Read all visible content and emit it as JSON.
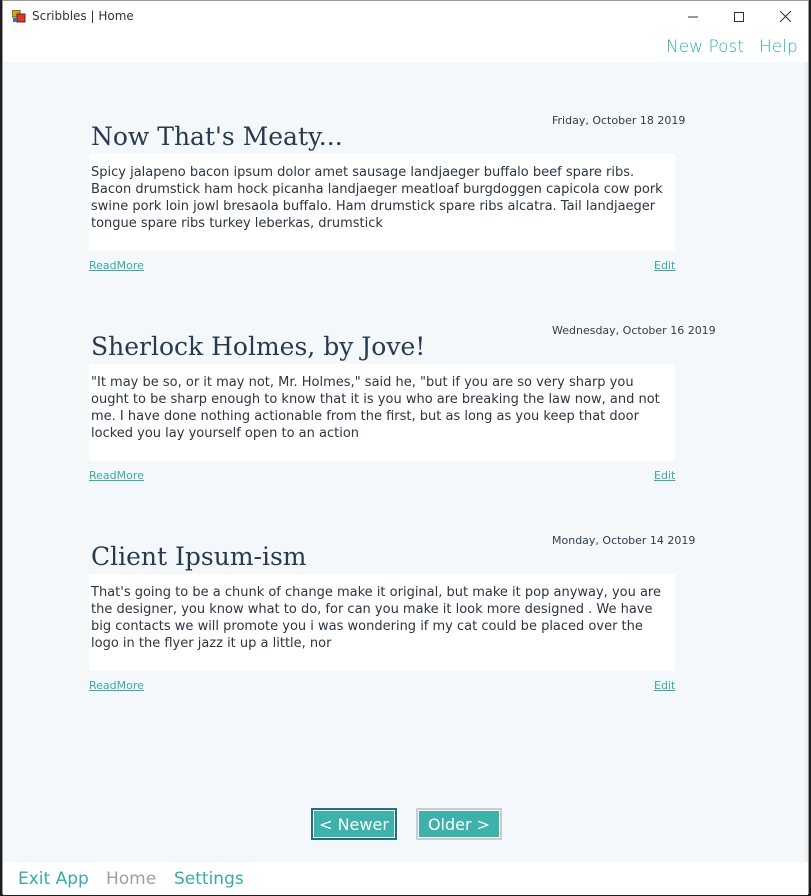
{
  "window": {
    "title": "Scribbles | Home"
  },
  "menu": {
    "new_post": "New Post",
    "help": "Help"
  },
  "posts": [
    {
      "date": "Friday, October 18 2019",
      "title": "Now That's Meaty...",
      "body": "Spicy jalapeno bacon ipsum dolor amet sausage landjaeger buffalo beef spare ribs. Bacon drumstick ham hock picanha landjaeger meatloaf burgdoggen capicola cow pork swine pork loin jowl bresaola buffalo. Ham drumstick spare ribs alcatra. Tail landjaeger tongue spare ribs turkey leberkas, drumstick",
      "read_more": "ReadMore",
      "edit": "Edit"
    },
    {
      "date": "Wednesday, October 16 2019",
      "title": "Sherlock Holmes, by Jove!",
      "body": "\"It may be so, or it may not, Mr. Holmes,\" said he, \"but if you are so very sharp you ought to be sharp enough to know that it is you who are breaking the law now, and not me. I have done nothing actionable from the first, but as long as you keep that door locked you lay yourself open to an action",
      "read_more": "ReadMore",
      "edit": "Edit"
    },
    {
      "date": "Monday, October 14 2019",
      "title": "Client Ipsum-ism",
      "body": "That's going to be a chunk of change make it original, but make it pop anyway, you are the designer, you know what to do, for can you make it look more designed . We have big contacts we will promote you i was wondering if my cat could be placed over the logo in the flyer jazz it up a little, nor",
      "read_more": "ReadMore",
      "edit": "Edit"
    }
  ],
  "pagination": {
    "newer": "< Newer",
    "older": "Older >"
  },
  "footer": {
    "exit": "Exit App",
    "home": "Home",
    "settings": "Settings"
  },
  "colors": {
    "accent": "#37aba8",
    "button": "#3cb2ab",
    "background": "#f4f8fb",
    "title": "#273a4f",
    "home_muted": "#9aa0a6"
  },
  "icons": {
    "app": "app-icon",
    "minimize": "minimize-icon",
    "maximize": "maximize-icon",
    "close": "close-icon"
  }
}
